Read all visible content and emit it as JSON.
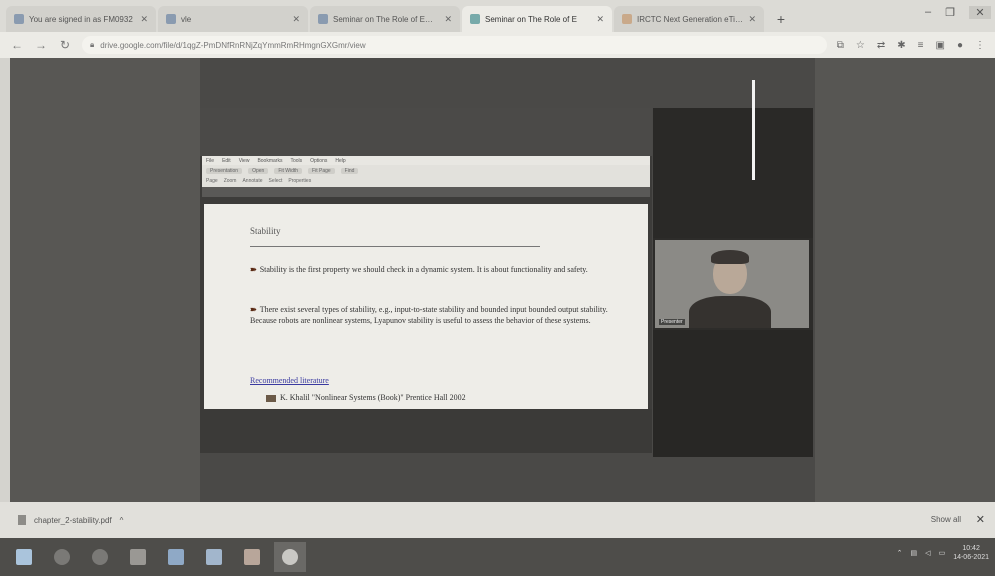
{
  "browser": {
    "tabs": [
      {
        "label": "You are signed in as FM0932",
        "icon": "mail-icon",
        "active": false
      },
      {
        "label": "vle",
        "icon": "page-icon",
        "active": false
      },
      {
        "label": "Seminar on The Role of Emerg",
        "icon": "mail-icon",
        "active": false
      },
      {
        "label": "Seminar on The Role of E",
        "icon": "meet-icon",
        "active": true
      },
      {
        "label": "IRCTC Next Generation eTicke",
        "icon": "train-icon",
        "active": false
      }
    ],
    "new_tab": "+",
    "url": "drive.google.com/file/d/1qgZ-PmDNfRnRNjZqYmmRmRHmgnGXGmr/view",
    "window_controls": {
      "minimize": "–",
      "maximize": "❐",
      "close": "✕"
    }
  },
  "shared_app": {
    "menu": [
      "File",
      "Edit",
      "View",
      "Bookmarks",
      "Tools",
      "Options",
      "Help"
    ],
    "toolbar_row1": [
      "Presentation",
      "Open",
      "Fit Width",
      "Fit Page",
      "Find"
    ],
    "toolbar_row2": [
      "Page",
      "Zoom",
      "Annotate",
      "Select",
      "Properties"
    ]
  },
  "slide": {
    "title": "Stability",
    "bullets": [
      "Stability is the first property we should check in a dynamic system. It is about functionality and safety.",
      "There exist several types of stability, e.g., input-to-state stability and bounded input bounded output stability. Because robots are nonlinear systems, Lyapunov stability is useful to assess the behavior of these systems."
    ],
    "references_heading": "Recommended literature",
    "reference": "K. Khalil \"Nonlinear Systems (Book)\" Prentice Hall 2002"
  },
  "participant": {
    "name": "Presenter"
  },
  "download_bar": {
    "filename": "chapter_2-stability.pdf",
    "show_all": "Show all",
    "close": "✕"
  },
  "taskbar": {
    "apps": [
      "start",
      "ie",
      "chrome",
      "explorer",
      "word",
      "outlook",
      "powerpoint",
      "chrome-g"
    ],
    "time": "10:42",
    "date": "14-06-2021"
  }
}
